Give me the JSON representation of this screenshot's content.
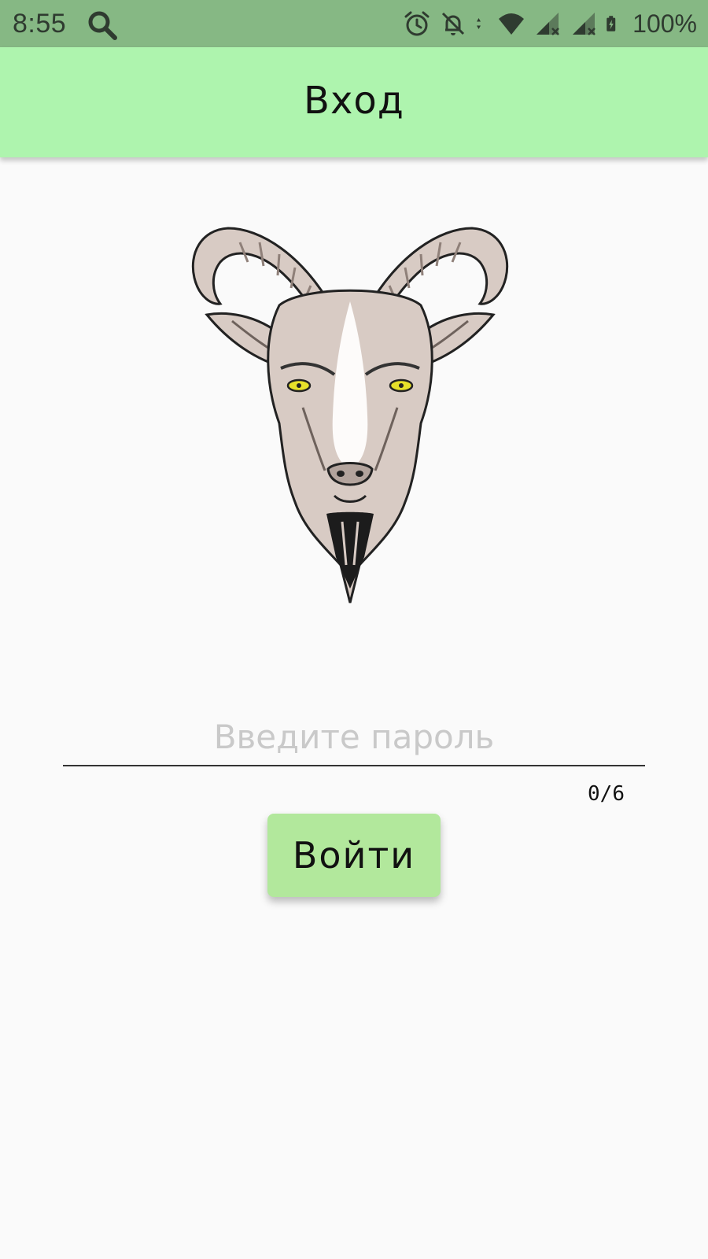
{
  "status_bar": {
    "time": "8:55",
    "battery_text": "100%",
    "icons": [
      "search-icon",
      "alarm-icon",
      "notifications-off-icon",
      "data-transfer-icon",
      "wifi-icon",
      "signal-icon",
      "signal-icon",
      "battery-charging-icon"
    ],
    "background": "#86b884"
  },
  "app_bar": {
    "title": "Вход",
    "background": "#aef4ae"
  },
  "logo": {
    "icon": "goat-head-icon"
  },
  "login_form": {
    "password_placeholder": "Введите пароль",
    "password_value": "",
    "char_counter": "0/6",
    "submit_label": "Войти",
    "button_color": "#b2e89c"
  }
}
